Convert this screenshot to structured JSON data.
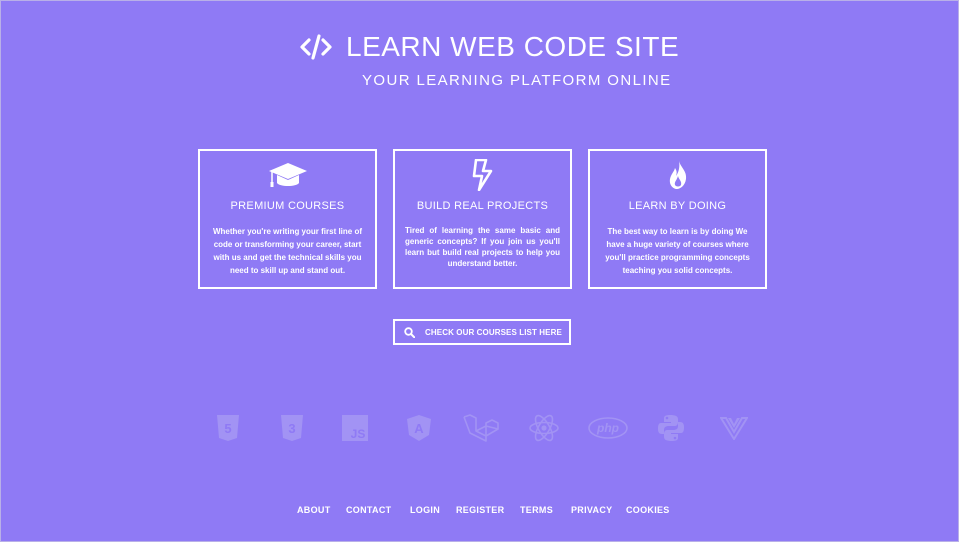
{
  "header": {
    "logo_icon": "code-icon",
    "title": "LEARN WEB CODE SITE",
    "tagline": "YOUR LEARNING PLATFORM ONLINE"
  },
  "cards": [
    {
      "icon": "graduation-cap-icon",
      "title": "PREMIUM COURSES",
      "text": "Whether you're writing your first line of code or transforming your career, start with us and get the technical skills you need to skill up and stand out."
    },
    {
      "icon": "lightning-bolt-icon",
      "title": "BUILD REAL PROJECTS",
      "text": "Tired of learning the same basic and generic concepts? If you join us you'll learn but build real projects to help you understand better."
    },
    {
      "icon": "flame-icon",
      "title": "LEARN BY DOING",
      "text": "The best way to learn is by doing We have a huge variety of courses where you'll practice programming concepts teaching you solid concepts."
    }
  ],
  "cta": {
    "icon": "search-icon",
    "label": "CHECK OUR COURSES LIST HERE"
  },
  "technologies": [
    {
      "icon": "html5-icon",
      "label": "5"
    },
    {
      "icon": "css3-icon",
      "label": "3"
    },
    {
      "icon": "javascript-icon",
      "label": "JS"
    },
    {
      "icon": "angular-icon",
      "label": "A"
    },
    {
      "icon": "laravel-icon"
    },
    {
      "icon": "react-icon"
    },
    {
      "icon": "php-icon",
      "label": "php"
    },
    {
      "icon": "python-icon"
    },
    {
      "icon": "vue-icon"
    }
  ],
  "footer": {
    "links": [
      "ABOUT",
      "CONTACT",
      "LOGIN",
      "REGISTER",
      "TERMS",
      "PRIVACY",
      "COOKIES"
    ]
  },
  "colors": {
    "background": "#8f7af5",
    "foreground": "#ffffff",
    "tech_icon": "#a293f4"
  }
}
